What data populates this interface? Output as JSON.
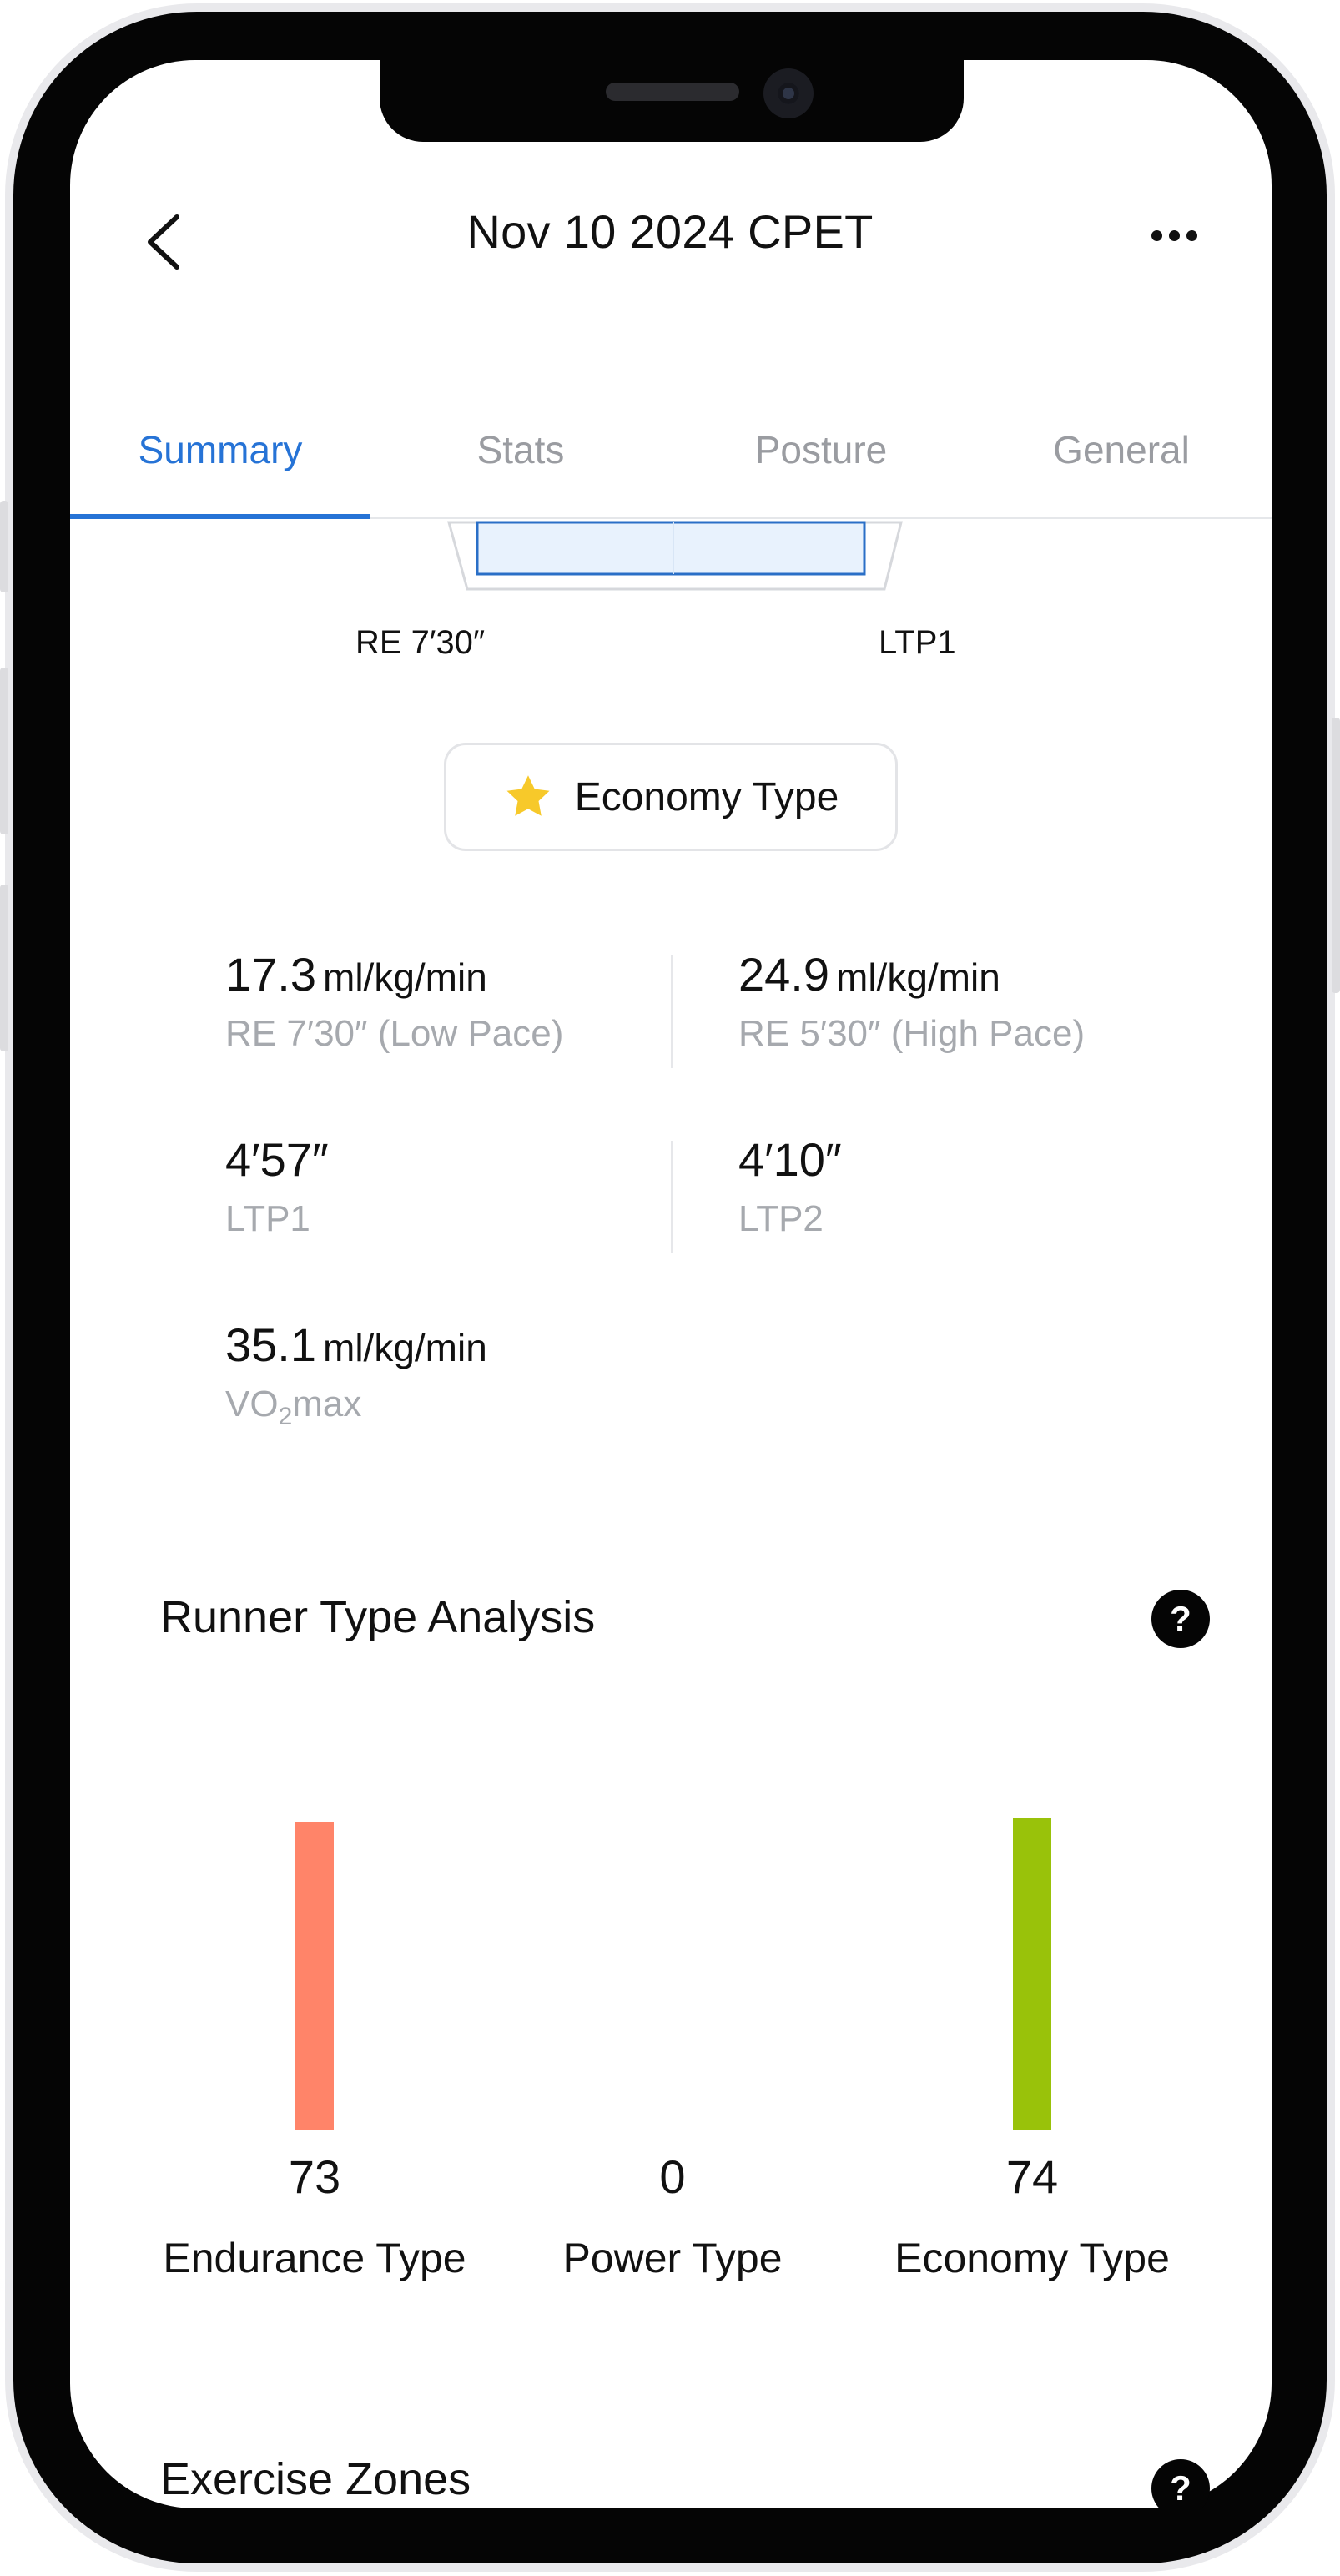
{
  "header": {
    "title": "Nov 10 2024 CPET"
  },
  "tabs": [
    {
      "label": "Summary",
      "active": true
    },
    {
      "label": "Stats",
      "active": false
    },
    {
      "label": "Posture",
      "active": false
    },
    {
      "label": "General",
      "active": false
    }
  ],
  "threshold_chart": {
    "left_label": "RE 7′30″",
    "right_label": "LTP1"
  },
  "runner_type_badge": {
    "label": "Economy Type",
    "icon": "star-icon",
    "icon_color": "#F7C92A"
  },
  "metrics": {
    "re_low": {
      "value": "17.3",
      "unit": "ml/kg/min",
      "label": "RE 7′30″ (Low Pace)"
    },
    "re_high": {
      "value": "24.9",
      "unit": "ml/kg/min",
      "label": "RE 5′30″ (High Pace)"
    },
    "ltp1": {
      "value": "4′57″",
      "label": "LTP1"
    },
    "ltp2": {
      "value": "4′10″",
      "label": "LTP2"
    },
    "vo2max": {
      "value": "35.1",
      "unit": "ml/kg/min",
      "label_prefix": "VO",
      "label_sub": "2",
      "label_suffix": "max"
    }
  },
  "runner_type_analysis": {
    "title": "Runner Type Analysis",
    "help_label": "?"
  },
  "chart_data": {
    "type": "bar",
    "categories": [
      "Endurance Type",
      "Power Type",
      "Economy Type"
    ],
    "values": [
      73,
      0,
      74
    ],
    "value_labels": [
      "73",
      "0",
      "74"
    ],
    "colors": [
      "#FF8469",
      "#9ACD1E",
      "#99C20A"
    ],
    "ylim": [
      0,
      74
    ]
  },
  "exercise_zones": {
    "title": "Exercise Zones",
    "help_label": "?"
  },
  "colors": {
    "accent": "#2673D6",
    "muted_text": "#A6A9AE"
  }
}
